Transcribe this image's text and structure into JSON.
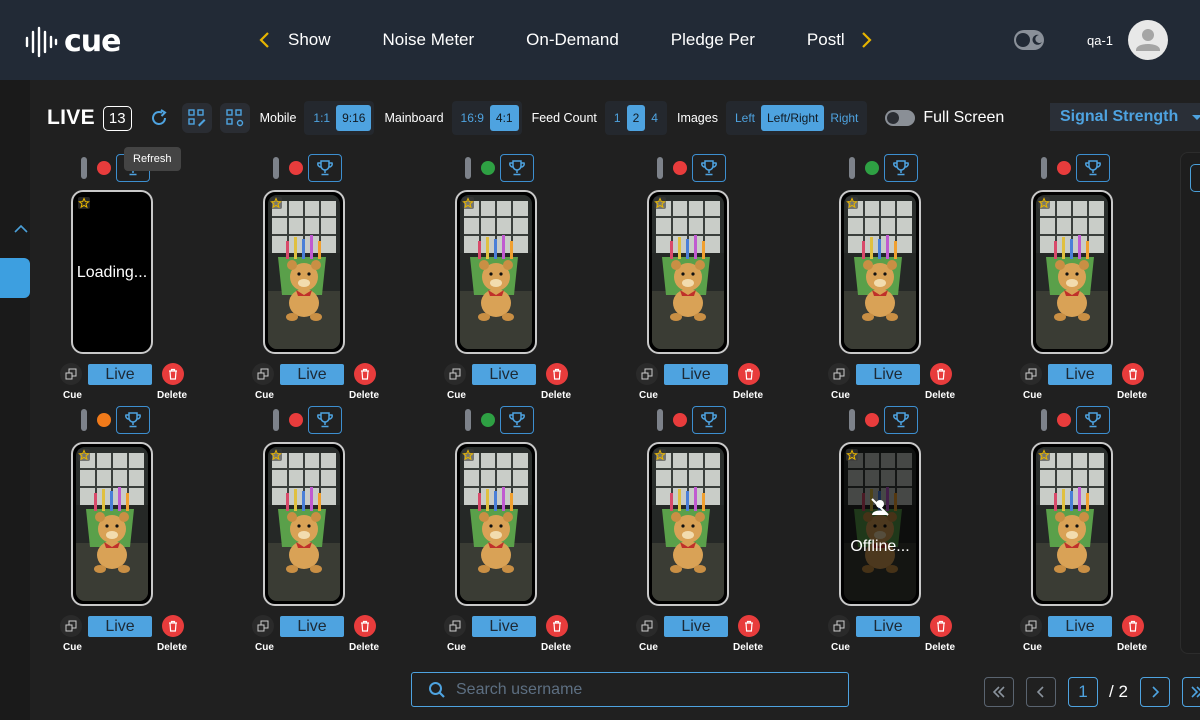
{
  "app": {
    "logo_text": "cue"
  },
  "nav": {
    "tabs": [
      "Show",
      "Noise Meter",
      "On-Demand",
      "Pledge Per",
      "Postl"
    ]
  },
  "user": {
    "name": "qa-1"
  },
  "toolbar": {
    "live_label": "LIVE",
    "live_count": "13",
    "mobile_label": "Mobile",
    "mobile_options": [
      "1:1",
      "9:16"
    ],
    "mobile_selected": "9:16",
    "mainboard_label": "Mainboard",
    "mainboard_options": [
      "16:9",
      "4:1"
    ],
    "mainboard_selected": "4:1",
    "feed_count_label": "Feed Count",
    "feed_count_options": [
      "1",
      "2",
      "4"
    ],
    "feed_count_selected": "2",
    "images_label": "Images",
    "images_options": [
      "Left",
      "Left/Right",
      "Right"
    ],
    "images_selected": "Left/Right",
    "full_screen_label": "Full Screen",
    "sort_select": "Signal Strength"
  },
  "tooltip": {
    "text": "Refresh"
  },
  "colors": {
    "accent": "#4ea3e0",
    "red": "#e83c3c",
    "green": "#2ea043",
    "orange": "#f07a1a",
    "nav_bg": "#222a36",
    "gold": "#e6b400"
  },
  "card_labels": {
    "live": "Live",
    "cue": "Cue",
    "delete": "Delete"
  },
  "cards": [
    {
      "status": "red",
      "state": "loading",
      "overlay": "Loading..."
    },
    {
      "status": "red",
      "state": "video"
    },
    {
      "status": "green",
      "state": "video"
    },
    {
      "status": "red",
      "state": "video"
    },
    {
      "status": "green",
      "state": "video"
    },
    {
      "status": "red",
      "state": "video"
    },
    {
      "status": "orange",
      "state": "video"
    },
    {
      "status": "red",
      "state": "video"
    },
    {
      "status": "green",
      "state": "video"
    },
    {
      "status": "red",
      "state": "video"
    },
    {
      "status": "red",
      "state": "offline",
      "overlay": "Offline..."
    },
    {
      "status": "red",
      "state": "video"
    }
  ],
  "search": {
    "placeholder": "Search username",
    "value": ""
  },
  "pagination": {
    "current": "1",
    "total": "/ 2"
  }
}
